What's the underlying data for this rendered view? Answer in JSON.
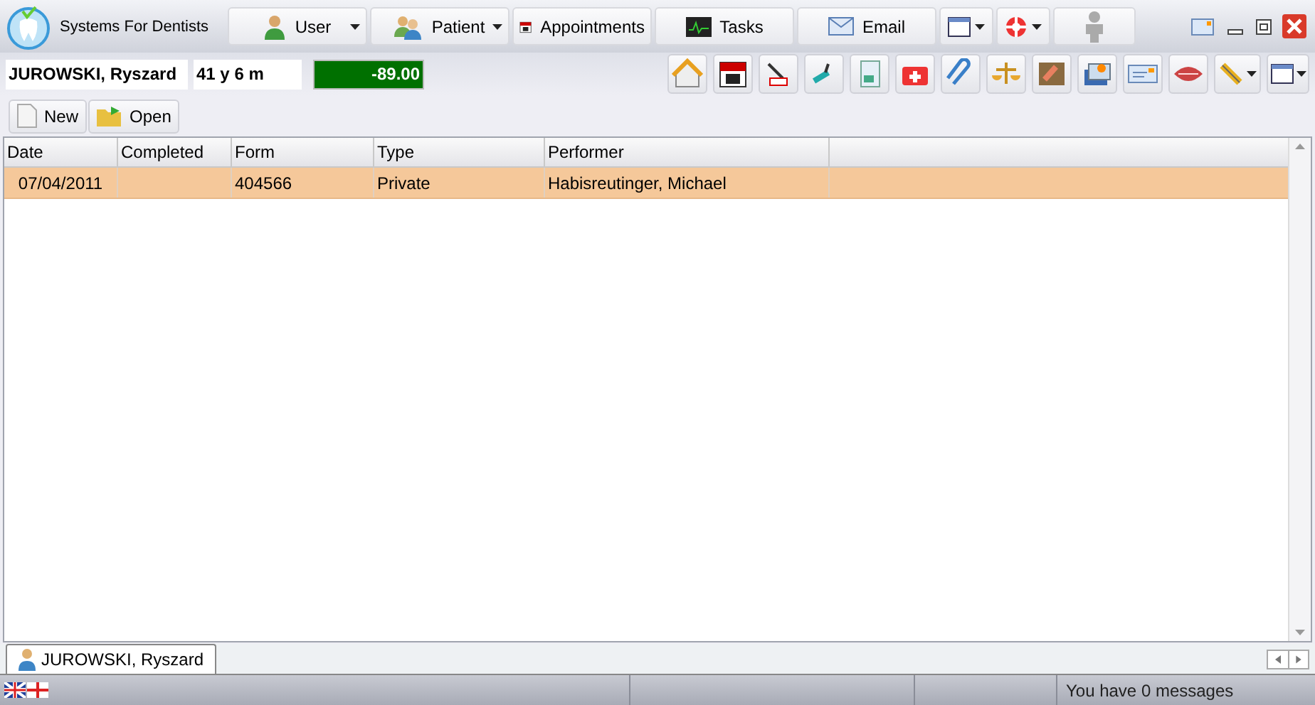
{
  "app_title": "Systems For Dentists",
  "nav": [
    {
      "label": "User",
      "kind": "dropdown"
    },
    {
      "label": "Patient",
      "kind": "dropdown"
    },
    {
      "label": "Appointments",
      "kind": "plain"
    },
    {
      "label": "Tasks",
      "kind": "plain"
    },
    {
      "label": "Email",
      "kind": "plain"
    }
  ],
  "patient": {
    "name": "JUROWSKI, Ryszard",
    "age": "41 y 6 m",
    "balance": "-89.00"
  },
  "actions": [
    {
      "label": "New"
    },
    {
      "label": "Open"
    }
  ],
  "table": {
    "columns": [
      "Date",
      "Completed",
      "Form",
      "Type",
      "Performer"
    ],
    "rows": [
      {
        "cells": [
          "07/04/2011",
          "",
          "404566",
          "Private",
          "Habisreutinger, Michael"
        ],
        "selected": true
      }
    ]
  },
  "tab": {
    "label": "JUROWSKI, Ryszard"
  },
  "status_bar": {
    "message": "You have 0 messages"
  }
}
